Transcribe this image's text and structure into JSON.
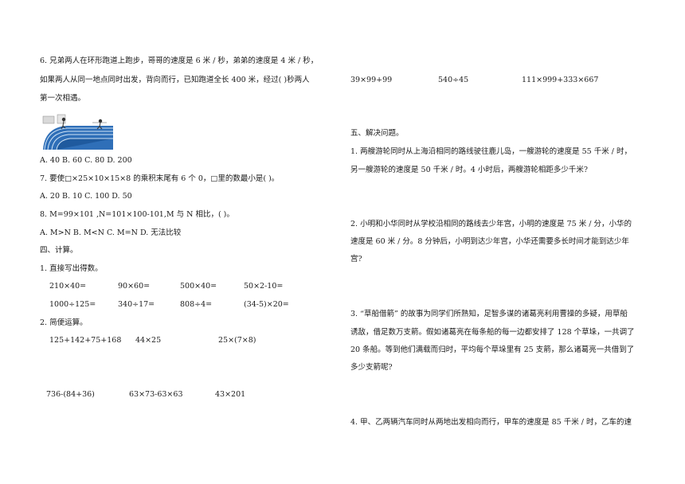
{
  "left": {
    "q6": {
      "line1": "6. 兄弟两人在环形跑道上跑步，哥哥的速度是 6 米 / 秒，弟弟的速度是 4 米 / 秒，",
      "line2": "如果两人从同一地点同时出发，背向而行，已知跑道全长 400 米，经过(      )秒两人",
      "line3": "第一次相遇。",
      "options": "A. 40     B. 60     C. 80     D. 200"
    },
    "q7": {
      "text": "7. 要使□×25×10×15×8 的乘积末尾有 6 个 0，□里的数最小是(      )。",
      "options": "A. 20     B. 10     C. 100     D. 50"
    },
    "q8": {
      "text": "8. M=99×101 ,N=101×100-101,M 与 N 相比，(      )。",
      "options": "A. M>N     B. M<N     C. M=N     D. 无法比较"
    },
    "section4": "四、计算。",
    "calc1": {
      "title": "1. 直接写出得数。",
      "row1": [
        "210×40=",
        "90×60=",
        "500×40=",
        "50×2-10="
      ],
      "row2": [
        "1000÷125=",
        "340÷17=",
        "808÷4=",
        "(34-5)×20="
      ]
    },
    "calc2": {
      "title": "2. 简便运算。",
      "row1": [
        "125+142+75+168",
        "44×25",
        "25×(7×8)"
      ],
      "row2": [
        "736-(84+36)",
        "63×73-63×63",
        "43×201"
      ]
    }
  },
  "right": {
    "calc_row": [
      "39×99+99",
      "540÷45",
      "111×999+333×667"
    ],
    "section5": "五、解决问题。",
    "p1": {
      "line1": "1. 两艘游轮同时从上海沿相同的路线驶往鹿儿岛，一艘游轮的速度是 55 千米 / 时，",
      "line2": "另一艘游轮的速度是 50 千米 / 时。4 小时后，两艘游轮相距多少千米?"
    },
    "p2": {
      "line1": "2. 小明和小华同时从学校沿相同的路线去少年宫，小明的速度是 75 米 / 分，小华的",
      "line2": "速度是 60 米 / 分。8 分钟后，小明到达少年宫，小华还需要多长时间才能到达少年",
      "line3": "宫?"
    },
    "p3": {
      "line1": "3. “草船借箭” 的故事为同学们所熟知，足智多谋的诸葛亮利用曹操的多疑，用草船",
      "line2": "诱敌，借足数万支箭。假如诸葛亮在每条船的每一边都安排了 128 个草垛，一共调了",
      "line3": "20 条船。等到他们满载而归时，平均每个草垛里有 25 支箭，那么诸葛亮一共借到了",
      "line4": "多少支箭呢?"
    },
    "p4": {
      "line1": "4. 甲、乙两辆汽车同时从两地出发相向而行，甲车的速度是 85 千米 / 时，乙车的速"
    }
  }
}
